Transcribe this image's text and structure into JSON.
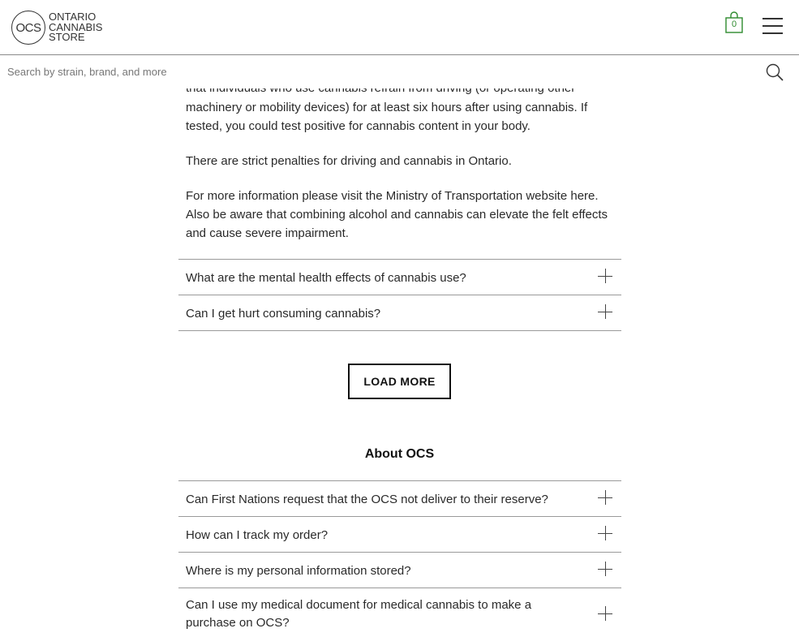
{
  "header": {
    "logo_mark": "OCS",
    "logo_lines": [
      "ONTARIO",
      "CANNABIS",
      "STORE"
    ],
    "cart_count": "0",
    "accent_color": "#2d8a2d"
  },
  "search": {
    "placeholder": "Search by strain, brand, and more"
  },
  "article": {
    "partial_line": "that individuals who use cannabis refrain from driving (or operating other",
    "paragraph1": "machinery or mobility devices) for at least six hours after using cannabis. If tested, you could test positive for cannabis content in your body.",
    "paragraph2": "There are strict penalties for driving and cannabis in Ontario.",
    "paragraph3": "For more information please visit the Ministry of Transportation website here.  Also be aware that combining alcohol and cannabis can elevate the felt effects and cause severe impairment."
  },
  "faq_health": [
    {
      "question": "What are the mental health effects of cannabis use?"
    },
    {
      "question": "Can I get hurt consuming cannabis?"
    }
  ],
  "load_more_label": "LOAD MORE",
  "about_section": {
    "title": "About OCS",
    "items": [
      {
        "question": "Can First Nations request that the OCS not deliver to their reserve?"
      },
      {
        "question": "How can I track my order?"
      },
      {
        "question": "Where is my personal information stored?"
      },
      {
        "question": "Can I use my medical document for medical cannabis to make a purchase on OCS?"
      }
    ]
  },
  "icons": {
    "cart": "shopping-bag-icon",
    "menu": "hamburger-menu-icon",
    "search": "search-icon",
    "expand": "plus-icon"
  }
}
